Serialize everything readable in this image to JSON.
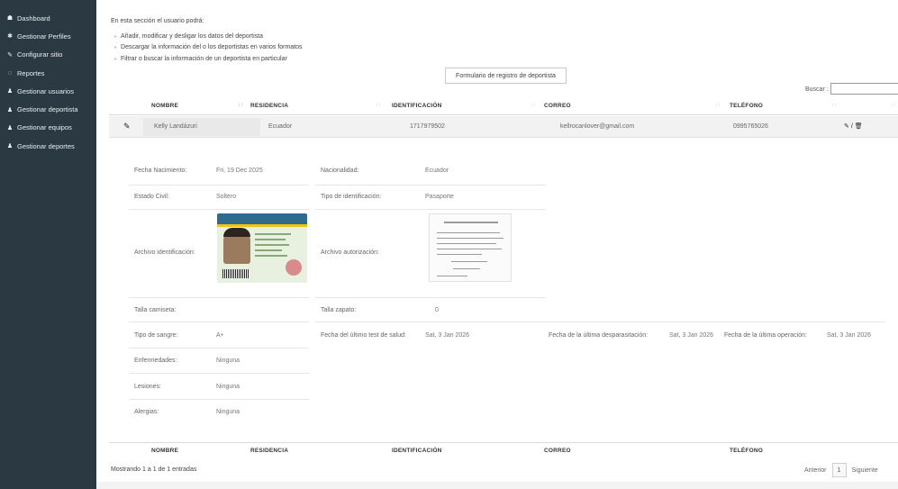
{
  "sidebar": {
    "items": [
      {
        "label": "Dashboard",
        "icon": "dashboard-icon",
        "glyph": "☗"
      },
      {
        "label": "Gestionar Perfiles",
        "icon": "gear-icon",
        "glyph": "✱"
      },
      {
        "label": "Configurar sitio",
        "icon": "wrench-icon",
        "glyph": "✎"
      },
      {
        "label": "Reportes",
        "icon": "chat-icon",
        "glyph": "◌"
      },
      {
        "label": "Gestionar usuarios",
        "icon": "user-icon",
        "glyph": "♟"
      },
      {
        "label": "Gestionar deportista",
        "icon": "user-icon",
        "glyph": "♟"
      },
      {
        "label": "Gestionar equipos",
        "icon": "user-icon",
        "glyph": "♟"
      },
      {
        "label": "Gestionar deportes",
        "icon": "user-icon",
        "glyph": "♟"
      }
    ]
  },
  "intro": "En esta sección el usuario podrá:",
  "bullets": [
    "Añadir, modificar y desligar los datos del deportista",
    "Descargar la información del o los deportistas en varios formatos",
    "Filtrar o buscar la información de un deportista en particular"
  ],
  "form_button": "Formulario de registro de deportista",
  "search_label": "Buscar :",
  "table": {
    "columns": [
      "NOMBRE",
      "RESIDENCIA",
      "IDENTIFICACIÓN",
      "CORREO",
      "TELÉFONO"
    ],
    "row": {
      "nombre": "Kelly Landázuri",
      "residencia": "Ecuador",
      "identificacion": "1717979502",
      "correo": "kellrocanlover@gmail.com",
      "telefono": "0995765026",
      "actions": "✎ / 🗑"
    }
  },
  "details": {
    "fecha_nacimiento_label": "Fecha Nacimiento:",
    "fecha_nacimiento": "Fri, 19 Dec 2025",
    "nacionalidad_label": "Nacionalidad:",
    "nacionalidad": "Ecuador",
    "estado_civil_label": "Estado Civil:",
    "estado_civil": "Soltero",
    "tipo_id_label": "Tipo de identificación:",
    "tipo_id": "Pasaporte",
    "archivo_id_label": "Archivo identificación:",
    "archivo_aut_label": "Archivo autorización:",
    "talla_camiseta_label": "Talla camiseta:",
    "talla_camiseta": "",
    "talla_zapato_label": "Talla zapato:",
    "talla_zapato": "0",
    "tipo_sangre_label": "Tipo de sangre:",
    "tipo_sangre": "A+",
    "test_salud_label": "Fecha del último test de salud:",
    "test_salud": "Sat, 3 Jan 2026",
    "desparasitacion_label": "Fecha de la última desparasitación:",
    "desparasitacion": "Sat, 3 Jan 2026",
    "operacion_label": "Fecha de la última operación:",
    "operacion": "Sat, 3 Jan 2026",
    "enfermedades_label": "Enfermedades:",
    "enfermedades": "Ninguna",
    "lesiones_label": "Lesiones:",
    "lesiones": "Ninguna",
    "alergias_label": "Alergias:",
    "alergias": "Ninguna"
  },
  "showing": "Mostrando 1 a 1 de 1 entradas",
  "pager": {
    "prev": "Anterior",
    "page": "1",
    "next": "Siguiente"
  }
}
